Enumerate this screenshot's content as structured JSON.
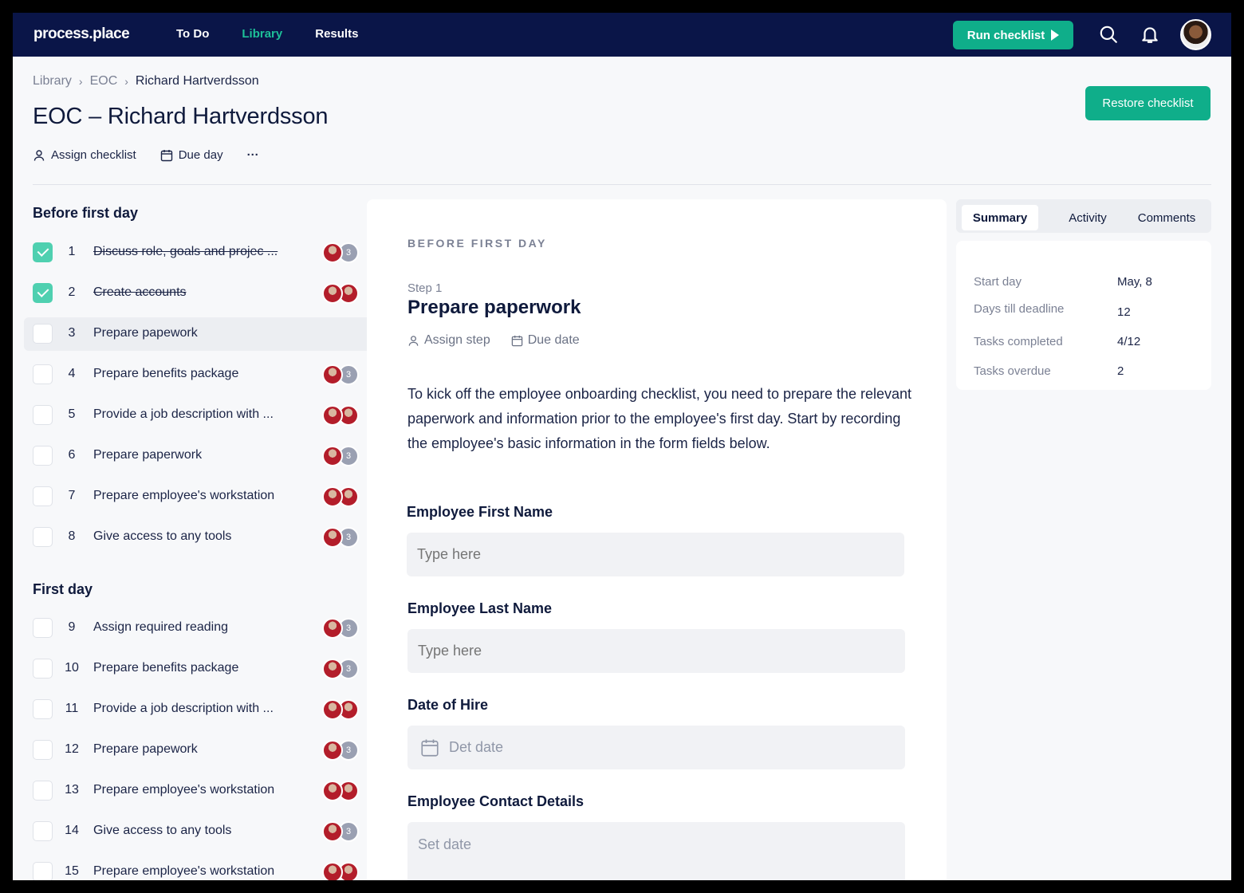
{
  "app": {
    "logo": "process.place"
  },
  "nav": [
    {
      "label": "To Do",
      "active": false
    },
    {
      "label": "Library",
      "active": true
    },
    {
      "label": "Results",
      "active": false
    }
  ],
  "run_button": "Run checklist",
  "icons": {
    "search": "search-icon",
    "bell": "bell-icon",
    "avatar": "user-avatar"
  },
  "breadcrumb": [
    "Library",
    "EOC",
    "Richard Hartverdsson"
  ],
  "page_title": "EOC – Richard Hartverdsson",
  "restore_button": "Restore checklist",
  "actions": {
    "assign": "Assign checklist",
    "due": "Due day",
    "more": "···"
  },
  "sections": [
    {
      "title": "Before first day",
      "items": [
        {
          "num": "1",
          "label": "Discuss role, goals and projec ...",
          "done": true,
          "avatars": [
            "person",
            "count"
          ],
          "count": "3"
        },
        {
          "num": "2",
          "label": "Create accounts",
          "done": true,
          "avatars": [
            "person",
            "person"
          ]
        },
        {
          "num": "3",
          "label": "Prepare papework",
          "done": false,
          "selected": true,
          "avatars": []
        },
        {
          "num": "4",
          "label": "Prepare benefits package",
          "done": false,
          "avatars": [
            "person",
            "count"
          ],
          "count": "3"
        },
        {
          "num": "5",
          "label": "Provide a job description with ...",
          "done": false,
          "avatars": [
            "person",
            "person"
          ]
        },
        {
          "num": "6",
          "label": "Prepare paperwork",
          "done": false,
          "avatars": [
            "person",
            "count"
          ],
          "count": "3"
        },
        {
          "num": "7",
          "label": "Prepare employee's workstation",
          "done": false,
          "avatars": [
            "person",
            "person"
          ]
        },
        {
          "num": "8",
          "label": "Give access to any tools",
          "done": false,
          "avatars": [
            "person",
            "count"
          ],
          "count": "3"
        }
      ]
    },
    {
      "title": "First day",
      "items": [
        {
          "num": "9",
          "label": "Assign required reading",
          "done": false,
          "avatars": [
            "person",
            "count"
          ],
          "count": "3"
        },
        {
          "num": "10",
          "label": "Prepare benefits package",
          "done": false,
          "avatars": [
            "person",
            "count"
          ],
          "count": "3"
        },
        {
          "num": "11",
          "label": "Provide a job description with ...",
          "done": false,
          "avatars": [
            "person",
            "person"
          ]
        },
        {
          "num": "12",
          "label": "Prepare papework",
          "done": false,
          "avatars": [
            "person",
            "count"
          ],
          "count": "3"
        },
        {
          "num": "13",
          "label": "Prepare employee's workstation",
          "done": false,
          "avatars": [
            "person",
            "person"
          ]
        },
        {
          "num": "14",
          "label": "Give access to any tools",
          "done": false,
          "avatars": [
            "person",
            "count"
          ],
          "count": "3"
        },
        {
          "num": "15",
          "label": "Prepare employee's workstation",
          "done": false,
          "avatars": [
            "person",
            "person"
          ]
        }
      ]
    }
  ],
  "step": {
    "kicker": "BEFORE FIRST DAY",
    "number": "Step 1",
    "title": "Prepare paperwork",
    "assign": "Assign step",
    "due": "Due date",
    "description": "To kick off the employee onboarding checklist, you need to prepare the relevant paperwork and information prior to the employee's first day. Start by recording the employee's basic information in the form fields below.",
    "fields": [
      {
        "label": "Employee First Name",
        "placeholder": "Type here"
      },
      {
        "label": "Employee Last Name",
        "placeholder": "Type here"
      },
      {
        "label": "Date of Hire",
        "placeholder": "Det date"
      },
      {
        "label": "Employee Contact Details",
        "placeholder": "Set date"
      }
    ]
  },
  "tabs": [
    {
      "label": "Summary",
      "active": true
    },
    {
      "label": "Activity",
      "active": false
    },
    {
      "label": "Comments",
      "active": false
    }
  ],
  "summary": [
    {
      "key": "Start day",
      "value": "May, 8"
    },
    {
      "key": "Days till deadline",
      "value": "12"
    },
    {
      "key": "Tasks completed",
      "value": "4/12"
    },
    {
      "key": "Tasks overdue",
      "value": "2"
    }
  ],
  "colors": {
    "navy": "#0a1548",
    "accent": "#0fae8a",
    "active_nav": "#1dbf98",
    "checked": "#4fd0b0"
  }
}
